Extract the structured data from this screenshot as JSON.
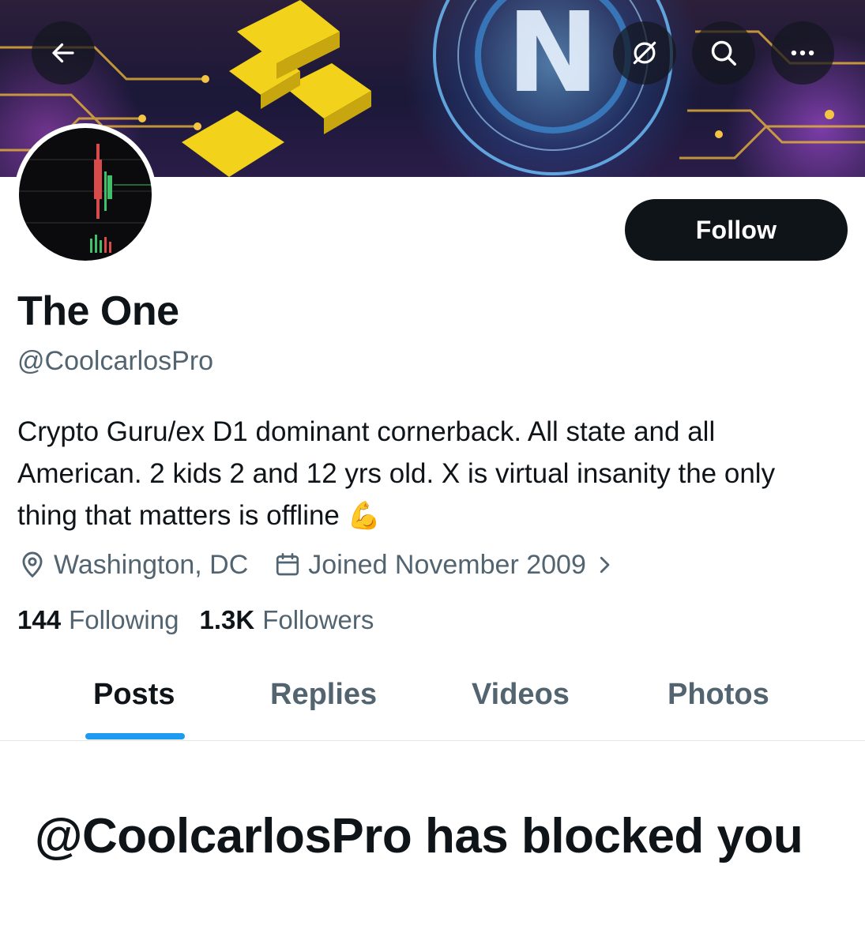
{
  "header": {
    "back_icon": "arrow-left-icon",
    "hide_icon": "eye-slash-icon",
    "search_icon": "search-icon",
    "more_icon": "ellipsis-icon"
  },
  "banner": {
    "letter": "N"
  },
  "profile": {
    "display_name": "The One",
    "handle": "@CoolcarlosPro",
    "follow_label": "Follow",
    "bio_text": "Crypto Guru/ex D1 dominant cornerback. All state and all American. 2 kids 2 and 12 yrs old. X is virtual insanity the only thing that matters is offline ",
    "bio_emoji": "💪",
    "location": "Washington, DC",
    "joined": "Joined November 2009",
    "following_count": "144",
    "following_label": "Following",
    "followers_count": "1.3K",
    "followers_label": "Followers"
  },
  "tabs": [
    {
      "label": "Posts",
      "active": true
    },
    {
      "label": "Replies",
      "active": false
    },
    {
      "label": "Videos",
      "active": false
    },
    {
      "label": "Photos",
      "active": false
    }
  ],
  "blocked_message": "@CoolcarlosPro has blocked you",
  "colors": {
    "accent": "#1d9bf0",
    "text_primary": "#0f1419",
    "text_secondary": "#536471",
    "button_bg": "#0f1419"
  }
}
